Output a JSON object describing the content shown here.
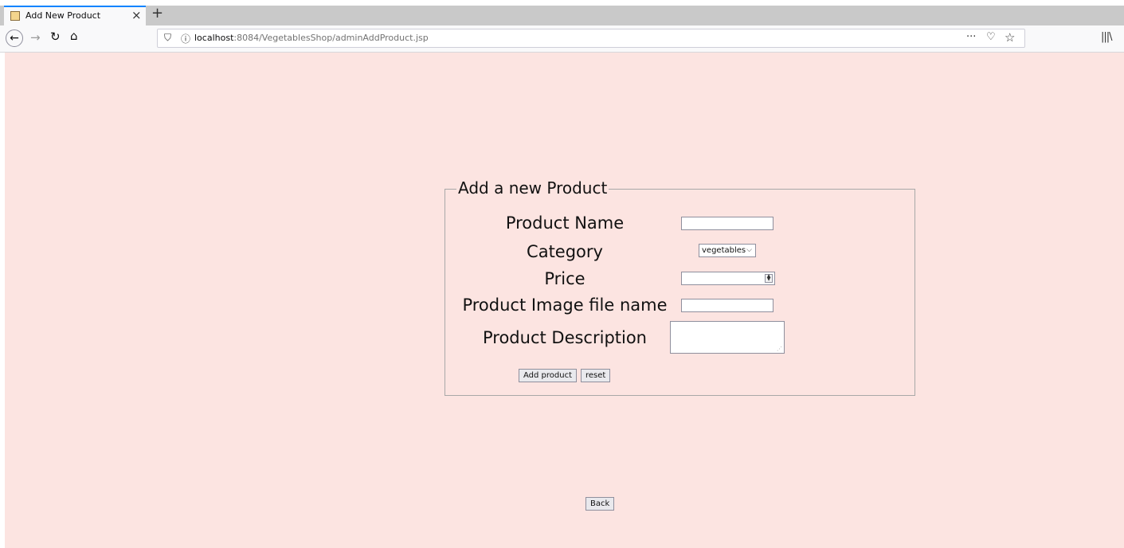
{
  "browser": {
    "tab_title": "Add New Product",
    "new_tab_glyph": "+",
    "close_glyph": "×",
    "url_host": "localhost",
    "url_rest": ":8084/VegetablesShop/adminAddProduct.jsp",
    "icons": [
      "back-icon",
      "forward-icon",
      "reload-icon",
      "home-icon",
      "shield-icon",
      "info-icon",
      "more-icon",
      "pocket-icon",
      "bookmark-star-icon",
      "library-icon"
    ],
    "accent_color": "#0a84ff"
  },
  "page": {
    "background_color": "#fce4e1",
    "form": {
      "legend": "Add a new Product",
      "product_name_label": "Product Name",
      "category_label": "Category",
      "category_selected": "vegetables",
      "price_label": "Price",
      "image_label": "Product Image file name",
      "description_label": "Product Description",
      "add_button": "Add product",
      "reset_button": "reset"
    },
    "back_button": "Back"
  }
}
